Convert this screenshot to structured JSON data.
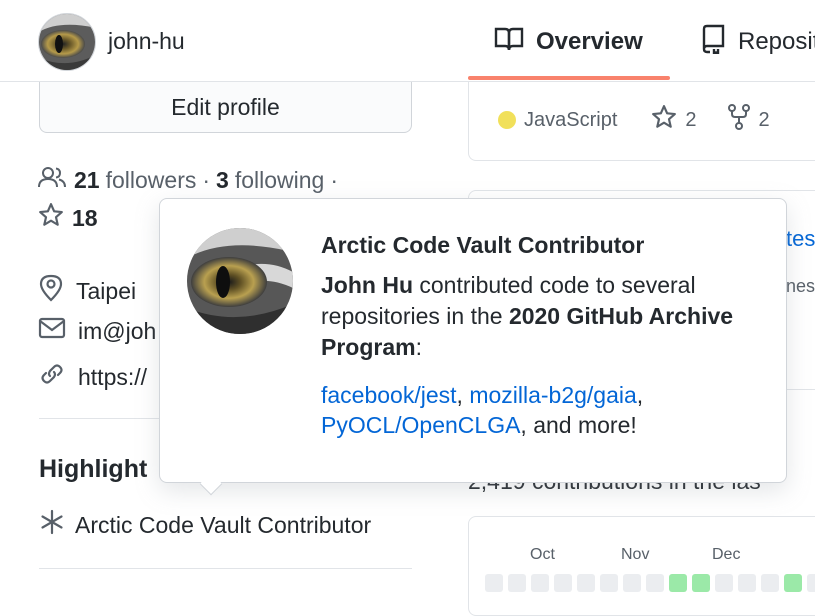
{
  "header": {
    "username": "john-hu",
    "tabs": [
      {
        "label": "Overview",
        "icon": "book-icon",
        "active": true
      },
      {
        "label": "Reposit",
        "icon": "repo-icon",
        "active": false
      }
    ],
    "accent_color": "#f9826c"
  },
  "profile": {
    "edit_button": "Edit profile",
    "followers_count": "21",
    "followers_label": "followers",
    "separator": "·",
    "following_count": "3",
    "following_label": "following",
    "stars_count": "18",
    "location": "Taipei",
    "email": "im@joh",
    "website": "https://",
    "highlights_heading": "Highlight",
    "highlight_item": "Arctic Code Vault Contributor"
  },
  "repo_card": {
    "language": "JavaScript",
    "language_color": "#f1e05a",
    "stars": "2",
    "forks": "2"
  },
  "repo_card_2": {
    "link_fragment": "tes",
    "desc_fragment": "ness"
  },
  "contributions": {
    "summary": "2,419 contributions in the las",
    "months": [
      "Oct",
      "Nov",
      "Dec"
    ]
  },
  "popover": {
    "title": "Arctic Code Vault Contributor",
    "body_name": "John Hu",
    "body_text_1": " contributed code to several repositories in the ",
    "body_program": "2020 GitHub Archive Program",
    "body_text_2": ":",
    "links": [
      "facebook/jest",
      "mozilla-b2g/gaia",
      "PyOCL/OpenCLGA"
    ],
    "link_sep_1": ", ",
    "link_sep_2": ", ",
    "trailing": ", and more!"
  }
}
